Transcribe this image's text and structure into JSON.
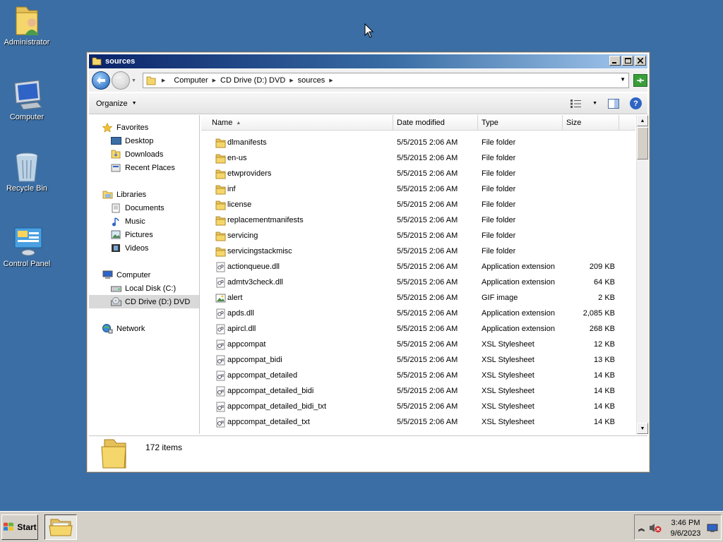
{
  "desktop": {
    "icons": [
      {
        "label": "Administrator",
        "icon": "user-folder-icon"
      },
      {
        "label": "Computer",
        "icon": "computer-icon"
      },
      {
        "label": "Recycle Bin",
        "icon": "recycle-bin-icon"
      },
      {
        "label": "Control Panel",
        "icon": "control-panel-icon"
      }
    ]
  },
  "window": {
    "title": "sources",
    "address": {
      "crumbs": [
        "Computer",
        "CD Drive (D:) DVD",
        "sources"
      ]
    },
    "toolbar": {
      "organize_label": "Organize"
    },
    "nav": {
      "favorites": "Favorites",
      "desktop": "Desktop",
      "downloads": "Downloads",
      "recent": "Recent Places",
      "libraries": "Libraries",
      "documents": "Documents",
      "music": "Music",
      "pictures": "Pictures",
      "videos": "Videos",
      "computer": "Computer",
      "local_disk": "Local Disk (C:)",
      "cd_drive": "CD Drive (D:) DVD",
      "network": "Network"
    },
    "columns": {
      "name": "Name",
      "date": "Date modified",
      "type": "Type",
      "size": "Size"
    },
    "files": [
      {
        "name": "dlmanifests",
        "date": "5/5/2015 2:06 AM",
        "type": "File folder",
        "size": "",
        "kind": "folder"
      },
      {
        "name": "en-us",
        "date": "5/5/2015 2:06 AM",
        "type": "File folder",
        "size": "",
        "kind": "folder"
      },
      {
        "name": "etwproviders",
        "date": "5/5/2015 2:06 AM",
        "type": "File folder",
        "size": "",
        "kind": "folder"
      },
      {
        "name": "inf",
        "date": "5/5/2015 2:06 AM",
        "type": "File folder",
        "size": "",
        "kind": "folder"
      },
      {
        "name": "license",
        "date": "5/5/2015 2:06 AM",
        "type": "File folder",
        "size": "",
        "kind": "folder"
      },
      {
        "name": "replacementmanifests",
        "date": "5/5/2015 2:06 AM",
        "type": "File folder",
        "size": "",
        "kind": "folder"
      },
      {
        "name": "servicing",
        "date": "5/5/2015 2:06 AM",
        "type": "File folder",
        "size": "",
        "kind": "folder"
      },
      {
        "name": "servicingstackmisc",
        "date": "5/5/2015 2:06 AM",
        "type": "File folder",
        "size": "",
        "kind": "folder"
      },
      {
        "name": "actionqueue.dll",
        "date": "5/5/2015 2:06 AM",
        "type": "Application extension",
        "size": "209 KB",
        "kind": "dll"
      },
      {
        "name": "admtv3check.dll",
        "date": "5/5/2015 2:06 AM",
        "type": "Application extension",
        "size": "64 KB",
        "kind": "dll"
      },
      {
        "name": "alert",
        "date": "5/5/2015 2:06 AM",
        "type": "GIF image",
        "size": "2 KB",
        "kind": "gif"
      },
      {
        "name": "apds.dll",
        "date": "5/5/2015 2:06 AM",
        "type": "Application extension",
        "size": "2,085 KB",
        "kind": "dll"
      },
      {
        "name": "apircl.dll",
        "date": "5/5/2015 2:06 AM",
        "type": "Application extension",
        "size": "268 KB",
        "kind": "dll"
      },
      {
        "name": "appcompat",
        "date": "5/5/2015 2:06 AM",
        "type": "XSL Stylesheet",
        "size": "12 KB",
        "kind": "xsl"
      },
      {
        "name": "appcompat_bidi",
        "date": "5/5/2015 2:06 AM",
        "type": "XSL Stylesheet",
        "size": "13 KB",
        "kind": "xsl"
      },
      {
        "name": "appcompat_detailed",
        "date": "5/5/2015 2:06 AM",
        "type": "XSL Stylesheet",
        "size": "14 KB",
        "kind": "xsl"
      },
      {
        "name": "appcompat_detailed_bidi",
        "date": "5/5/2015 2:06 AM",
        "type": "XSL Stylesheet",
        "size": "14 KB",
        "kind": "xsl"
      },
      {
        "name": "appcompat_detailed_bidi_txt",
        "date": "5/5/2015 2:06 AM",
        "type": "XSL Stylesheet",
        "size": "14 KB",
        "kind": "xsl"
      },
      {
        "name": "appcompat_detailed_txt",
        "date": "5/5/2015 2:06 AM",
        "type": "XSL Stylesheet",
        "size": "14 KB",
        "kind": "xsl"
      }
    ],
    "details": {
      "item_count": "172 items"
    }
  },
  "taskbar": {
    "start_label": "Start",
    "time": "3:46 PM",
    "date": "9/6/2023"
  },
  "colors": {
    "desktop": "#3a6ea5",
    "folder": "#f5d66b",
    "title_gradient_start": "#0a246a"
  }
}
